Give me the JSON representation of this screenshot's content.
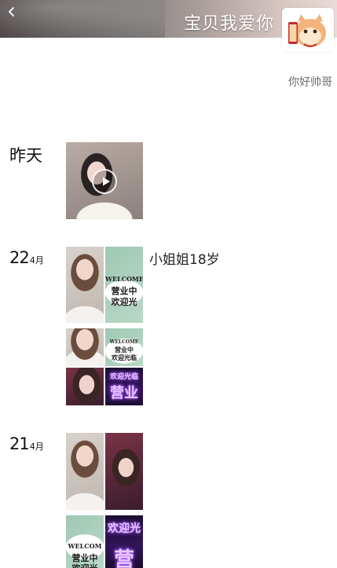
{
  "header": {
    "username": "宝贝我爱你",
    "back_icon": "chevron-left-icon",
    "avatar_icon": "fortune-cat-avatar"
  },
  "profile": {
    "signature": "你好帅哥"
  },
  "timeline": [
    {
      "date_label": "昨天",
      "media": [
        {
          "type": "video",
          "icon": "play-icon"
        }
      ]
    },
    {
      "day": "22",
      "month": "4月",
      "text": "小姐姐18岁",
      "media": [
        {
          "type": "image",
          "sign_text_1": "WELCOME",
          "sign_text_2": "营业中",
          "sign_text_3": "欢迎光"
        },
        {
          "type": "image",
          "sign_text_1": "WELCOME",
          "sign_text_2": "营业中",
          "sign_text_3": "欢迎光临",
          "neon_text_1": "欢迎光临",
          "neon_text_2": "营业"
        }
      ]
    },
    {
      "day": "21",
      "month": "4月",
      "media": [
        {
          "type": "image",
          "sign_text_1": "WELCOM",
          "sign_text_2": "营业中",
          "sign_text_3": "欢迎光",
          "neon_text_1": "欢迎光",
          "neon_text_2": "营"
        }
      ]
    }
  ]
}
